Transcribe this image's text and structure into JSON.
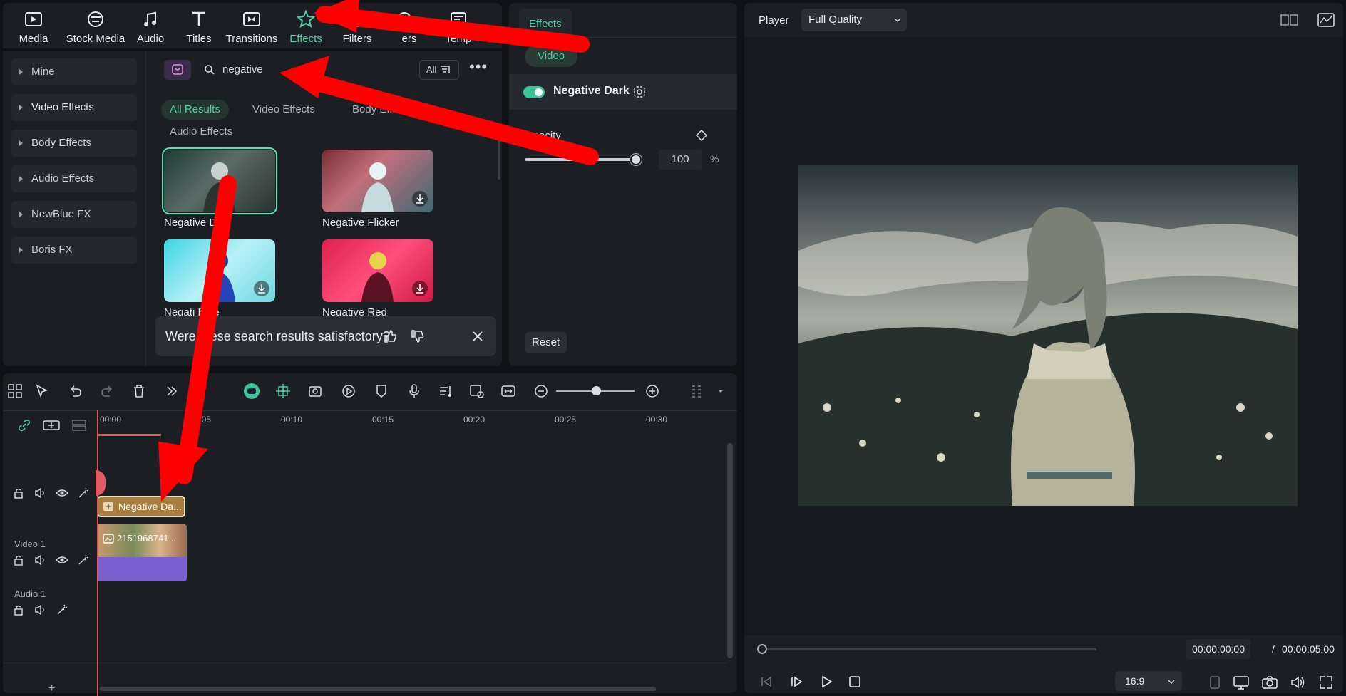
{
  "toolbar": {
    "items": [
      {
        "label": "Media",
        "icon": "media-icon"
      },
      {
        "label": "Stock Media",
        "icon": "stock-media-icon"
      },
      {
        "label": "Audio",
        "icon": "audio-icon"
      },
      {
        "label": "Titles",
        "icon": "titles-icon"
      },
      {
        "label": "Transitions",
        "icon": "transitions-icon"
      },
      {
        "label": "Effects",
        "icon": "effects-icon",
        "active": true
      },
      {
        "label": "Filters",
        "icon": "filters-icon"
      },
      {
        "label": "ers",
        "icon": "stickers-icon"
      },
      {
        "label": "Temp",
        "icon": "templates-icon"
      }
    ],
    "accent_color": "#4fd1a5"
  },
  "library": {
    "categories": [
      "Mine",
      "Video Effects",
      "Body Effects",
      "Audio Effects",
      "NewBlue FX",
      "Boris FX"
    ],
    "search_value": "negative",
    "filter_label": "All",
    "subtabs": [
      "All Results",
      "Video Effects",
      "Body Eff"
    ],
    "section_label": "Audio Effects",
    "results": [
      {
        "label": "Negative D",
        "selected": true
      },
      {
        "label": "Negative Flicker"
      },
      {
        "label": "Negati  Blue"
      },
      {
        "label": "Negative Red"
      }
    ],
    "feedback_text": "Were these search results satisfactory?"
  },
  "effects_panel": {
    "tab": "Effects",
    "video_pill": "Video",
    "effect_name": "Negative Dark",
    "opacity_label": "Opacity",
    "opacity_value": "100",
    "opacity_unit": "%",
    "opacity_level": 1.0,
    "reset_label": "Reset"
  },
  "player": {
    "title": "Player",
    "quality": "Full Quality",
    "current_time": "00:00:00:00",
    "separator": "/",
    "total_time": "00:00:05:00",
    "ratio": "16:9"
  },
  "timeline": {
    "ruler_labels": [
      "00:00",
      "00:05",
      "00:10",
      "00:15",
      "00:20",
      "00:25",
      "00:30"
    ],
    "tracks": [
      {
        "name": ""
      },
      {
        "name": "Video 1"
      },
      {
        "name": "Audio 1"
      }
    ],
    "effect_clip_label": "Negative Da...",
    "video_clip_label": "2151968741..."
  },
  "annotation_color": "#ff0000"
}
